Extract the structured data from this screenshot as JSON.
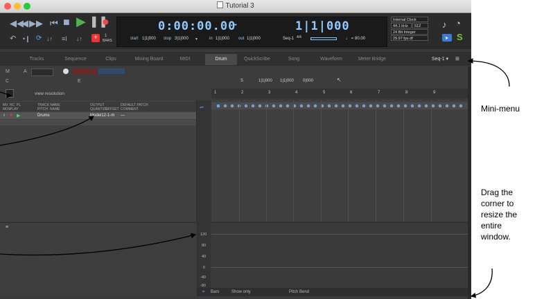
{
  "window": {
    "title": "Tutorial 3"
  },
  "transport": {
    "main_counter": "0:00:00.00",
    "counter_suffix": "-",
    "start_label": "start",
    "start_value": "1|1|000",
    "stop_label": "stop",
    "stop_value": "3|1|000",
    "in_label": "in",
    "in_value": "1|1|000",
    "out_label": "out",
    "out_value": "1|1|000",
    "bars_counter": "1|1|000",
    "bars_label": "BARS",
    "bars_value": "1",
    "seq_selector": "Seq-1",
    "time_sig": "4/4",
    "tempo_label": "♩ =",
    "tempo_value": "80.00"
  },
  "clock_panel": {
    "source": "Internal Clock",
    "sample_rate": "44.1 kHz",
    "buffer": "512",
    "bit_depth": "24 Bit Integer",
    "frame_rate": "29.97 fps df"
  },
  "tabs": [
    {
      "label": "Tracks"
    },
    {
      "label": "Sequence"
    },
    {
      "label": "Clips"
    },
    {
      "label": "Mixing Board"
    },
    {
      "label": "MIDI"
    },
    {
      "label": "Drum"
    },
    {
      "label": "QuickScribe"
    },
    {
      "label": "Song"
    },
    {
      "label": "Waveform"
    },
    {
      "label": "Meter Bridge"
    }
  ],
  "active_tab": "Drum",
  "seq_menu": "Seq-1",
  "toolbar": {
    "m": "M",
    "a": "A",
    "c": "C",
    "e": "E",
    "view_resolution": "view resolution",
    "s": "S",
    "pos_start": "1|1|000",
    "pos_end": "1|1|000",
    "pos_len": "0|000"
  },
  "track_table": {
    "headers": [
      "MV\nMOV",
      "RC\nPLAY",
      "PL",
      "TRACK NAME\nPITCH NAME",
      "OUTPUT\nQUANTIZE",
      "OFFSET",
      "DEFAULT PATCH\nCOMMENT"
    ],
    "header_line1": [
      "MV",
      "RC",
      "PL",
      "TRACK NAME",
      "OUTPUT",
      "",
      "DEFAULT PATCH"
    ],
    "header_line2": [
      "MOV",
      "PLAY",
      "",
      "PITCH",
      "NAME",
      "QUANTIZE",
      "OFFSET",
      "COMMENT"
    ],
    "row": {
      "name": "Drums",
      "output": "Model12-1-m",
      "patch": "—"
    }
  },
  "ruler": [
    "1",
    "2",
    "3",
    "4",
    "5",
    "6",
    "7",
    "8",
    "9"
  ],
  "velocity_axis": [
    "120",
    "80",
    "40",
    "0",
    "-40",
    "-80"
  ],
  "bottom_bar": {
    "units": "Bars",
    "show": "Show only",
    "controller": "Pitch Bend"
  },
  "callouts": {
    "mini_menu": "Mini-menu",
    "resize_line1": "Drag the",
    "resize_line2": "corner to",
    "resize_line3": "resize the",
    "resize_line4": "entire",
    "resize_line5": "window."
  }
}
